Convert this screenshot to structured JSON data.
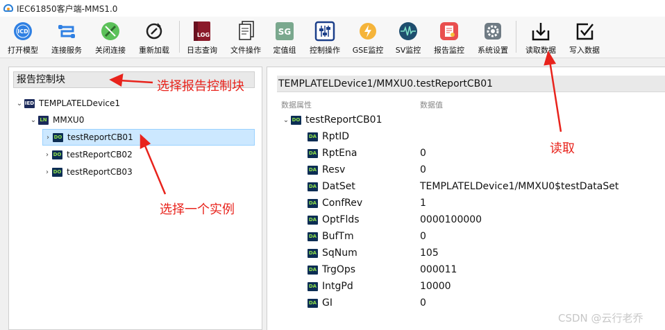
{
  "window": {
    "title": "IEC61850客户端-MMS1.0"
  },
  "toolbar": {
    "items": [
      {
        "label": "打开模型",
        "icon": "icd-icon"
      },
      {
        "label": "连接服务",
        "icon": "connect-icon"
      },
      {
        "label": "关闭连接",
        "icon": "disconnect-icon"
      },
      {
        "label": "重新加载",
        "icon": "reload-icon"
      },
      {
        "label": "日志查询",
        "icon": "log-icon"
      },
      {
        "label": "文件操作",
        "icon": "file-icon"
      },
      {
        "label": "定值组",
        "icon": "sg-icon"
      },
      {
        "label": "控制操作",
        "icon": "control-icon"
      },
      {
        "label": "GSE监控",
        "icon": "gse-icon"
      },
      {
        "label": "SV监控",
        "icon": "sv-icon"
      },
      {
        "label": "报告监控",
        "icon": "report-icon"
      },
      {
        "label": "系统设置",
        "icon": "settings-icon"
      },
      {
        "label": "读取数据",
        "icon": "read-icon"
      },
      {
        "label": "写入数据",
        "icon": "write-icon"
      }
    ],
    "icon_text": {
      "icd": "ICD",
      "log": "LOG",
      "sg": "SG"
    }
  },
  "left": {
    "header": "报告控制块",
    "tree": {
      "device": {
        "badge": "IED",
        "label": "TEMPLATELDevice1"
      },
      "ln": {
        "badge": "LN",
        "label": "MMXU0"
      },
      "items": [
        {
          "badge": "DO",
          "label": "testReportCB01"
        },
        {
          "badge": "DO",
          "label": "testReportCB02"
        },
        {
          "badge": "DO",
          "label": "testReportCB03"
        }
      ]
    }
  },
  "right": {
    "header": "TEMPLATELDevice1/MMXU0.testReportCB01",
    "columns": {
      "attr": "数据属性",
      "value": "数据值"
    },
    "root": {
      "badge": "DO",
      "label": "testReportCB01"
    },
    "rows": [
      {
        "badge": "DA",
        "name": "RptID",
        "value": ""
      },
      {
        "badge": "DA",
        "name": "RptEna",
        "value": "0"
      },
      {
        "badge": "DA",
        "name": "Resv",
        "value": "0"
      },
      {
        "badge": "DA",
        "name": "DatSet",
        "value": "TEMPLATELDevice1/MMXU0$testDataSet"
      },
      {
        "badge": "DA",
        "name": "ConfRev",
        "value": "1"
      },
      {
        "badge": "DA",
        "name": "OptFlds",
        "value": "0000100000"
      },
      {
        "badge": "DA",
        "name": "BufTm",
        "value": "0"
      },
      {
        "badge": "DA",
        "name": "SqNum",
        "value": "105"
      },
      {
        "badge": "DA",
        "name": "TrgOps",
        "value": "000011"
      },
      {
        "badge": "DA",
        "name": "IntgPd",
        "value": "10000"
      },
      {
        "badge": "DA",
        "name": "GI",
        "value": "0"
      }
    ]
  },
  "annotations": {
    "select_block": "选择报告控制块",
    "select_instance": "选择一个实例",
    "read": "读取",
    "color": "#e8231c"
  },
  "watermark": "CSDN @云行老乔"
}
